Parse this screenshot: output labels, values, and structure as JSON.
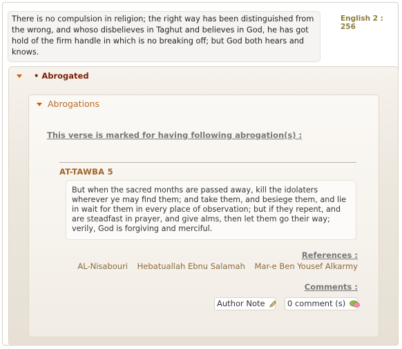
{
  "verse": {
    "text": "There is no compulsion in religion; the right way has been distinguished from the wrong, and whoso disbelieves in Taghut and believes in God, he has got hold of the firm handle in which is no breaking off; but God both hears and knows.",
    "reference": "English 2 : 256"
  },
  "abrogated": {
    "title": "• Abrogated"
  },
  "abrogations": {
    "title": "Abrogations",
    "marked_text": "This verse is marked for having following abrogation(s) :",
    "surah": "AT-TAWBA 5",
    "verse_text": "But when the sacred months are passed away, kill the idolaters wherever ye may find them; and take them, and besiege them, and lie in wait for them in every place of observation; but if they repent, and are steadfast in prayer, and give alms, then let them go their way; verily, God is forgiving and merciful.",
    "references_label": "References :",
    "authors": [
      "AL-Nisabouri",
      "Hebatuallah Ebnu Salamah",
      "Mar-e Ben Yousef Alkarmy"
    ],
    "comments_label": "Comments :",
    "author_note_label": "Author Note",
    "comment_count_label": "0 comment (s)"
  },
  "icons": {
    "collapse": "triangle-down-icon",
    "author_note": "pencil-icon",
    "comment": "speech-bubble-icon"
  },
  "colors": {
    "accent": "#d45a00",
    "heading": "#7a1d05",
    "link": "#8b6a3d"
  }
}
